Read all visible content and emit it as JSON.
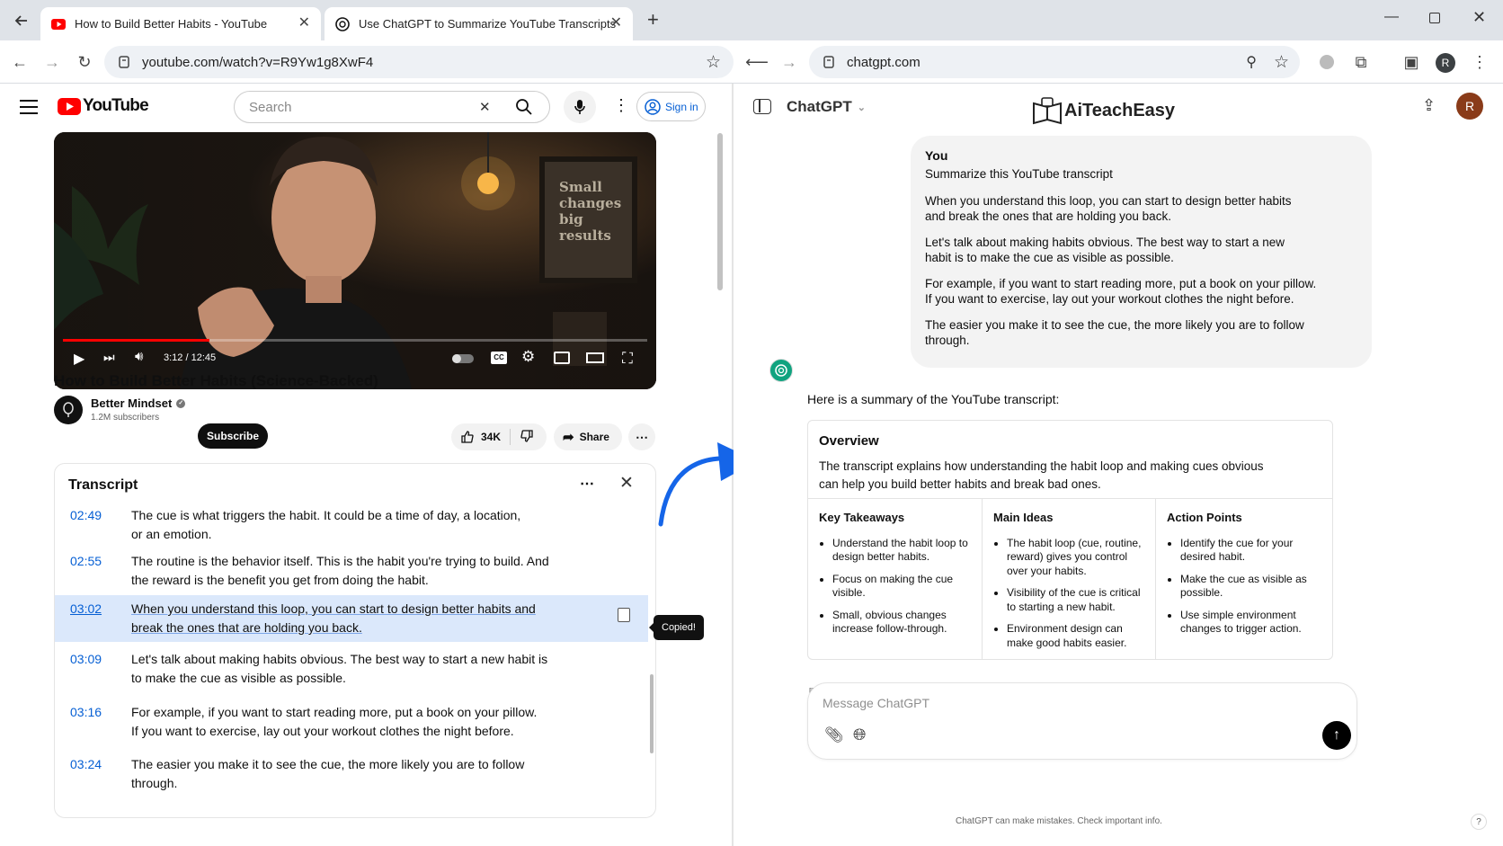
{
  "browser": {
    "tabs": [
      {
        "title": "How to Build Better Habits - YouTube",
        "active": true
      },
      {
        "title": "Use ChatGPT to Summarize YouTube Transcripts",
        "active": true
      }
    ],
    "left_url": "youtube.com/watch?v=R9Yw1g8XwF4",
    "right_url": "chatgpt.com",
    "profile_initial": "R"
  },
  "youtube": {
    "logo_text": "YouTube",
    "search_placeholder": "Search",
    "sign_in": "Sign in",
    "video": {
      "time": "3:12 / 12:45",
      "progress": 0.25,
      "poster_text": "Small changes big results"
    },
    "title": "How to Build Better Habits (Science-Backed)",
    "channel": {
      "name": "Better Mindset",
      "subscribers": "1.2M subscribers",
      "subscribe": "Subscribe"
    },
    "likes": "34K",
    "share": "Share",
    "transcript": {
      "title": "Transcript",
      "copied": "Copied!",
      "segments": [
        {
          "time": "02:49",
          "text": "The cue is what triggers the habit. It could be a time of day, a location, or an emotion."
        },
        {
          "time": "02:55",
          "text": "The routine is the behavior itself. This is the habit you're trying to build. And the reward is the benefit you get from doing the habit."
        },
        {
          "time": "03:02",
          "text": "When you understand this loop, you can start to design better habits and break the ones that are holding you back."
        },
        {
          "time": "03:09",
          "text": "Let's talk about making habits obvious. The best way to start a new habit is to make the cue as visible as possible."
        },
        {
          "time": "03:16",
          "text": "For example, if you want to start reading more, put a book on your pillow. If you want to exercise, lay out your workout clothes the night before."
        },
        {
          "time": "03:24",
          "text": "The easier you make it to see the cue, the more likely you are to follow through."
        }
      ]
    }
  },
  "chatgpt": {
    "model": "ChatGPT",
    "brand": "AiTeachEasy",
    "user_initial": "R",
    "user_message": {
      "sender": "You",
      "paragraphs": [
        "Summarize this YouTube transcript",
        "When you understand this loop, you can start to design better habits and break the ones that are holding you back.",
        "Let's talk about making habits obvious. The best way to start a new habit is to make the cue as visible as possible.",
        "For example, if you want to start reading more, put a book on your pillow. If you want to exercise, lay out your workout clothes the night before.",
        "The easier you make it to see the cue, the more likely you are to follow through."
      ]
    },
    "reply_intro": "Here is a summary of the YouTube transcript:",
    "overview": {
      "title": "Overview",
      "text": "The transcript explains how understanding the habit loop and making cues obvious can help you build better habits and break bad ones."
    },
    "columns": [
      {
        "title": "Key Takeaways",
        "items": [
          "Understand the habit loop to design better habits.",
          "Focus on making the cue visible.",
          "Small, obvious changes increase follow-through."
        ]
      },
      {
        "title": "Main Ideas",
        "items": [
          "The habit loop (cue, routine, reward) gives you control over your habits.",
          "Visibility of the cue is critical to starting a new habit.",
          "Environment design can make good habits easier."
        ]
      },
      {
        "title": "Action Points",
        "items": [
          "Identify the cue for your desired habit.",
          "Make the cue as visible as possible.",
          "Use simple environment changes to trigger action."
        ]
      }
    ],
    "input_placeholder": "Message ChatGPT",
    "disclaimer": "ChatGPT can make mistakes. Check important info.",
    "help": "?"
  },
  "colors": {
    "yt_red": "#ff0000",
    "link_blue": "#065fd4",
    "arrow_blue": "#1565e8",
    "gpt_green": "#10a37f",
    "highlight": "#dbe8fb"
  }
}
